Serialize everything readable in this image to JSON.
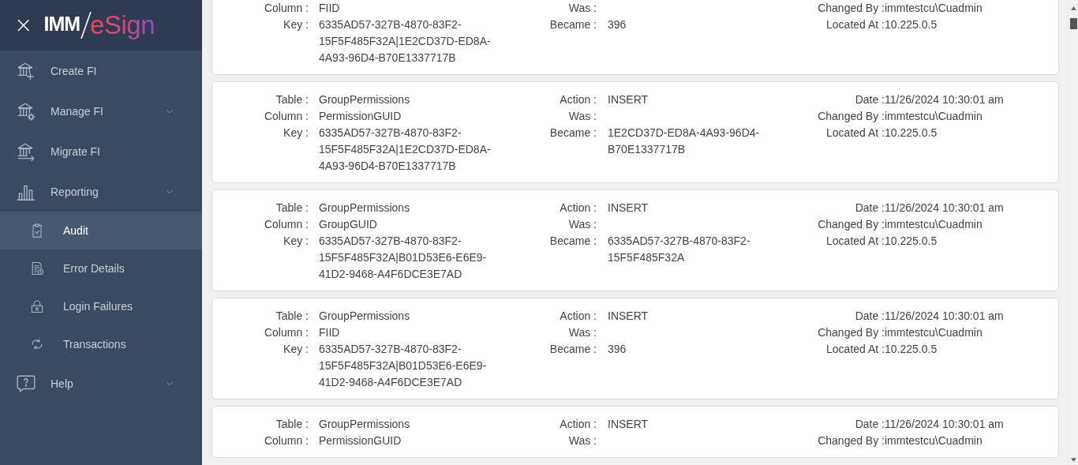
{
  "header": {
    "close": "×",
    "logo": {
      "first": "IMM",
      "second": "eSign"
    }
  },
  "sidebar": {
    "items": [
      {
        "label": "Create FI",
        "selected": false,
        "submenu": false
      },
      {
        "label": "Manage FI",
        "selected": false,
        "submenu": true
      },
      {
        "label": "Migrate FI",
        "selected": false,
        "submenu": false
      },
      {
        "label": "Reporting",
        "selected": false,
        "submenu": true,
        "children": [
          {
            "label": "Audit",
            "selected": true
          },
          {
            "label": "Error Details",
            "selected": false
          },
          {
            "label": "Login Failures",
            "selected": false
          },
          {
            "label": "Transactions",
            "selected": false
          }
        ]
      },
      {
        "label": "Help",
        "selected": false,
        "submenu": true
      }
    ]
  },
  "audit_records": [
    {
      "groups": [
        {
          "fields": [
            {
              "label": "Column :",
              "value": "FIID"
            },
            {
              "label": "Key :",
              "value": "6335AD57-327B-4870-83F2-15F5F485F32A|1E2CD37D-ED8A-4A93-96D4-B70E1337717B"
            }
          ]
        },
        {
          "fields": [
            {
              "label": "Was :"
            },
            {
              "label": "Became :",
              "value": "396"
            }
          ]
        },
        {
          "fields": [
            {
              "label": "Changed By :",
              "value": "immtestcu\\Cuadmin"
            },
            {
              "label": "Located At :",
              "value": "10.225.0.5"
            }
          ]
        }
      ]
    },
    {
      "groups": [
        {
          "fields": [
            {
              "label": "Table :",
              "value": "GroupPermissions"
            },
            {
              "label": "Column :",
              "value": "PermissionGUID"
            },
            {
              "label": "Key :",
              "value": "6335AD57-327B-4870-83F2-15F5F485F32A|1E2CD37D-ED8A-4A93-96D4-B70E1337717B"
            }
          ]
        },
        {
          "fields": [
            {
              "label": "Action :",
              "value": "INSERT"
            },
            {
              "label": "Was :"
            },
            {
              "label": "Became :",
              "value": "1E2CD37D-ED8A-4A93-96D4-B70E1337717B"
            }
          ]
        },
        {
          "fields": [
            {
              "label": "Date :",
              "value": "11/26/2024 10:30:01 am"
            },
            {
              "label": "Changed By :",
              "value": "immtestcu\\Cuadmin"
            },
            {
              "label": "Located At :",
              "value": "10.225.0.5"
            }
          ]
        }
      ]
    },
    {
      "groups": [
        {
          "fields": [
            {
              "label": "Table :",
              "value": "GroupPermissions"
            },
            {
              "label": "Column :",
              "value": "GroupGUID"
            },
            {
              "label": "Key :",
              "value": "6335AD57-327B-4870-83F2-15F5F485F32A|B01D53E6-E6E9-41D2-9468-A4F6DCE3E7AD"
            }
          ]
        },
        {
          "fields": [
            {
              "label": "Action :",
              "value": "INSERT"
            },
            {
              "label": "Was :"
            },
            {
              "label": "Became :",
              "value": "6335AD57-327B-4870-83F2-15F5F485F32A"
            }
          ]
        },
        {
          "fields": [
            {
              "label": "Date :",
              "value": "11/26/2024 10:30:01 am"
            },
            {
              "label": "Changed By :",
              "value": "immtestcu\\Cuadmin"
            },
            {
              "label": "Located At :",
              "value": "10.225.0.5"
            }
          ]
        }
      ]
    },
    {
      "groups": [
        {
          "fields": [
            {
              "label": "Table :",
              "value": "GroupPermissions"
            },
            {
              "label": "Column :",
              "value": "FIID"
            },
            {
              "label": "Key :",
              "value": "6335AD57-327B-4870-83F2-15F5F485F32A|B01D53E6-E6E9-41D2-9468-A4F6DCE3E7AD"
            }
          ]
        },
        {
          "fields": [
            {
              "label": "Action :",
              "value": "INSERT"
            },
            {
              "label": "Was :"
            },
            {
              "label": "Became :",
              "value": "396"
            }
          ]
        },
        {
          "fields": [
            {
              "label": "Date :",
              "value": "11/26/2024 10:30:01 am"
            },
            {
              "label": "Changed By :",
              "value": "immtestcu\\Cuadmin"
            },
            {
              "label": "Located At :",
              "value": "10.225.0.5"
            }
          ]
        }
      ]
    },
    {
      "groups": [
        {
          "fields": [
            {
              "label": "Table :",
              "value": "GroupPermissions"
            },
            {
              "label": "Column :",
              "value": "PermissionGUID"
            }
          ]
        },
        {
          "fields": [
            {
              "label": "Action :",
              "value": "INSERT"
            },
            {
              "label": "Was :"
            }
          ]
        },
        {
          "fields": [
            {
              "label": "Date :",
              "value": "11/26/2024 10:30:01 am"
            },
            {
              "label": "Changed By :",
              "value": "immtestcu\\Cuadmin"
            }
          ]
        }
      ]
    }
  ]
}
